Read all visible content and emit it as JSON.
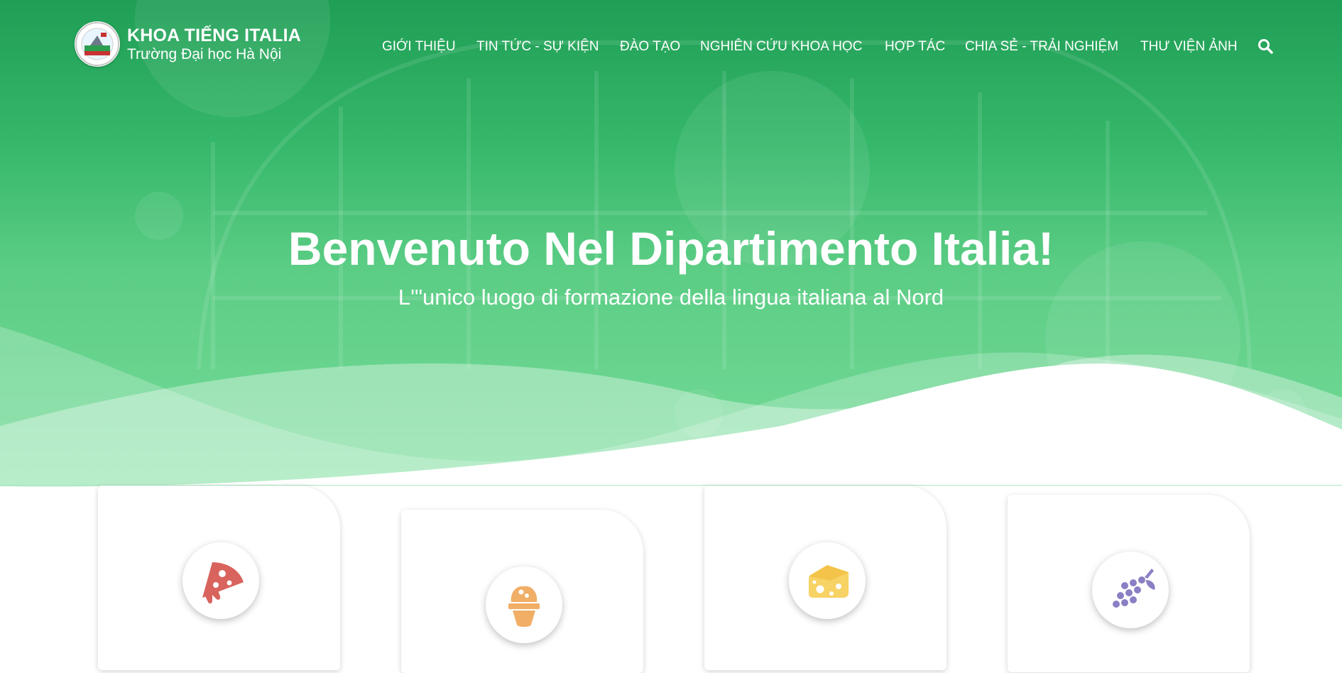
{
  "brand": {
    "title": "KHOA TIẾNG ITALIA",
    "subtitle": "Trường Đại học Hà Nội"
  },
  "nav": {
    "items": [
      {
        "label": "GIỚI THIỆU"
      },
      {
        "label": "TIN TỨC - SỰ KIỆN"
      },
      {
        "label": "ĐÀO TẠO"
      },
      {
        "label": "NGHIÊN CỨU KHOA HỌC"
      },
      {
        "label": "HỢP TÁC"
      },
      {
        "label": "CHIA SẺ - TRẢI NGHIỆM"
      },
      {
        "label": "THƯ VIỆN ẢNH"
      }
    ],
    "search_icon": "search-icon"
  },
  "hero": {
    "title": "Benvenuto Nel Dipartimento Italia!",
    "subtitle": "L'\"unico luogo di formazione della lingua italiana al Nord"
  },
  "cards": [
    {
      "icon": "pizza-icon",
      "icon_color": "#d9635d"
    },
    {
      "icon": "ice-cream-icon",
      "icon_color": "#f0ae66"
    },
    {
      "icon": "cheese-icon",
      "icon_color": "#f7d264"
    },
    {
      "icon": "grapes-icon",
      "icon_color": "#8a7fc4"
    }
  ],
  "colors": {
    "hero_green_top": "#1f9e55",
    "hero_green_bottom": "#76dc99",
    "text_on_hero": "#ffffff"
  }
}
